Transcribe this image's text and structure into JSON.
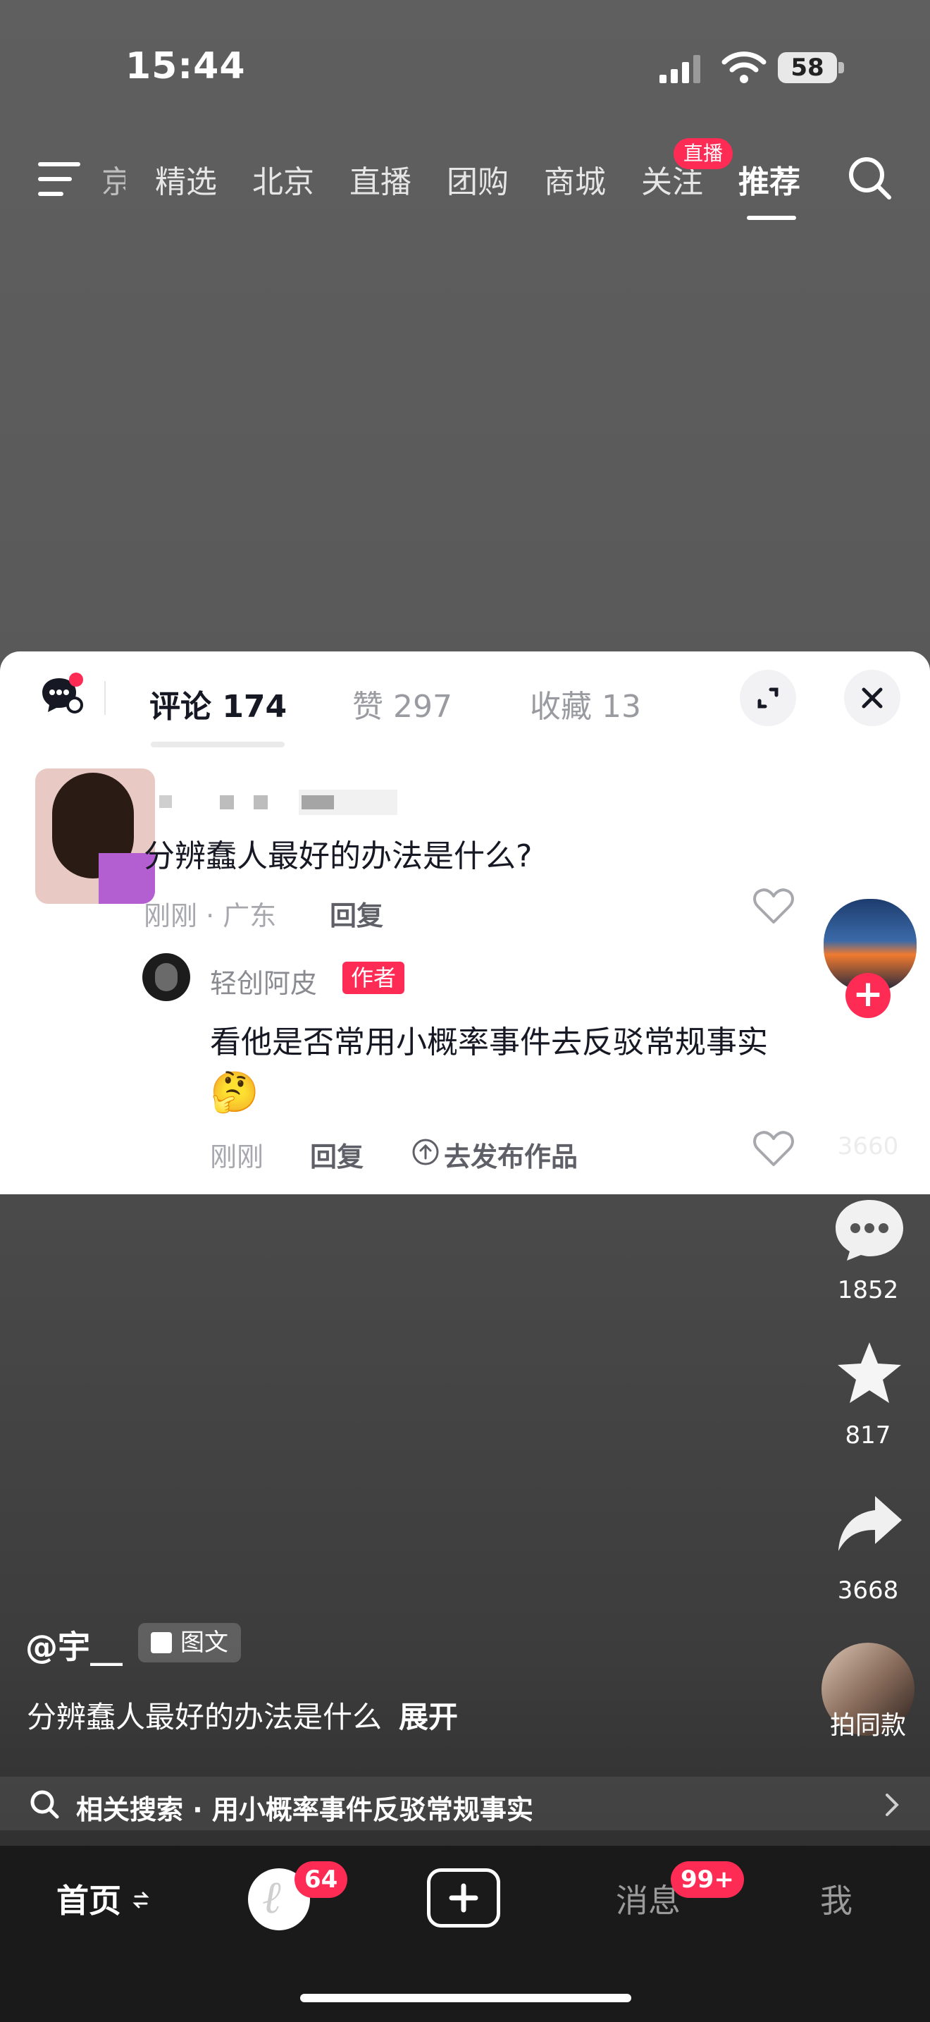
{
  "status_bar": {
    "time": "15:44",
    "battery": "58"
  },
  "top_tabs": {
    "items": [
      "京",
      "精选",
      "北京",
      "直播",
      "团购",
      "商城",
      "关注",
      "推荐"
    ],
    "active": "推荐",
    "live_badge": "直播"
  },
  "comment_panel": {
    "tabs": {
      "comments": "评论 174",
      "likes": "赞 297",
      "favorites": "收藏 13"
    },
    "comment": {
      "text": "分辨蠢人最好的办法是什么?",
      "meta": "刚刚 · 广东",
      "reply_label": "回复"
    },
    "reply": {
      "username": "轻创阿皮",
      "author_badge": "作者",
      "text": "看他是否常用小概率事件去反驳常规事实",
      "emoji": "🤔",
      "meta": "刚刚",
      "reply_label": "回复",
      "publish_label": "去发布作品"
    }
  },
  "sidebar": {
    "like_count": "3660",
    "comment_count": "1852",
    "favorite_count": "817",
    "share_count": "3668",
    "same_style_label": "拍同款"
  },
  "caption": {
    "author": "@宇__",
    "tag": "图文",
    "description": "分辨蠢人最好的办法是什么",
    "expand": "展开"
  },
  "related_search": {
    "text": "相关搜索 · 用小概率事件反驳常规事实"
  },
  "bottom_nav": {
    "home": "首页",
    "friends_badge": "64",
    "messages": "消息",
    "messages_badge": "99+",
    "me": "我"
  },
  "colors": {
    "accent": "#fe2c55",
    "panel_bg": "#ffffff",
    "nav_bg": "#1a1a1a"
  }
}
